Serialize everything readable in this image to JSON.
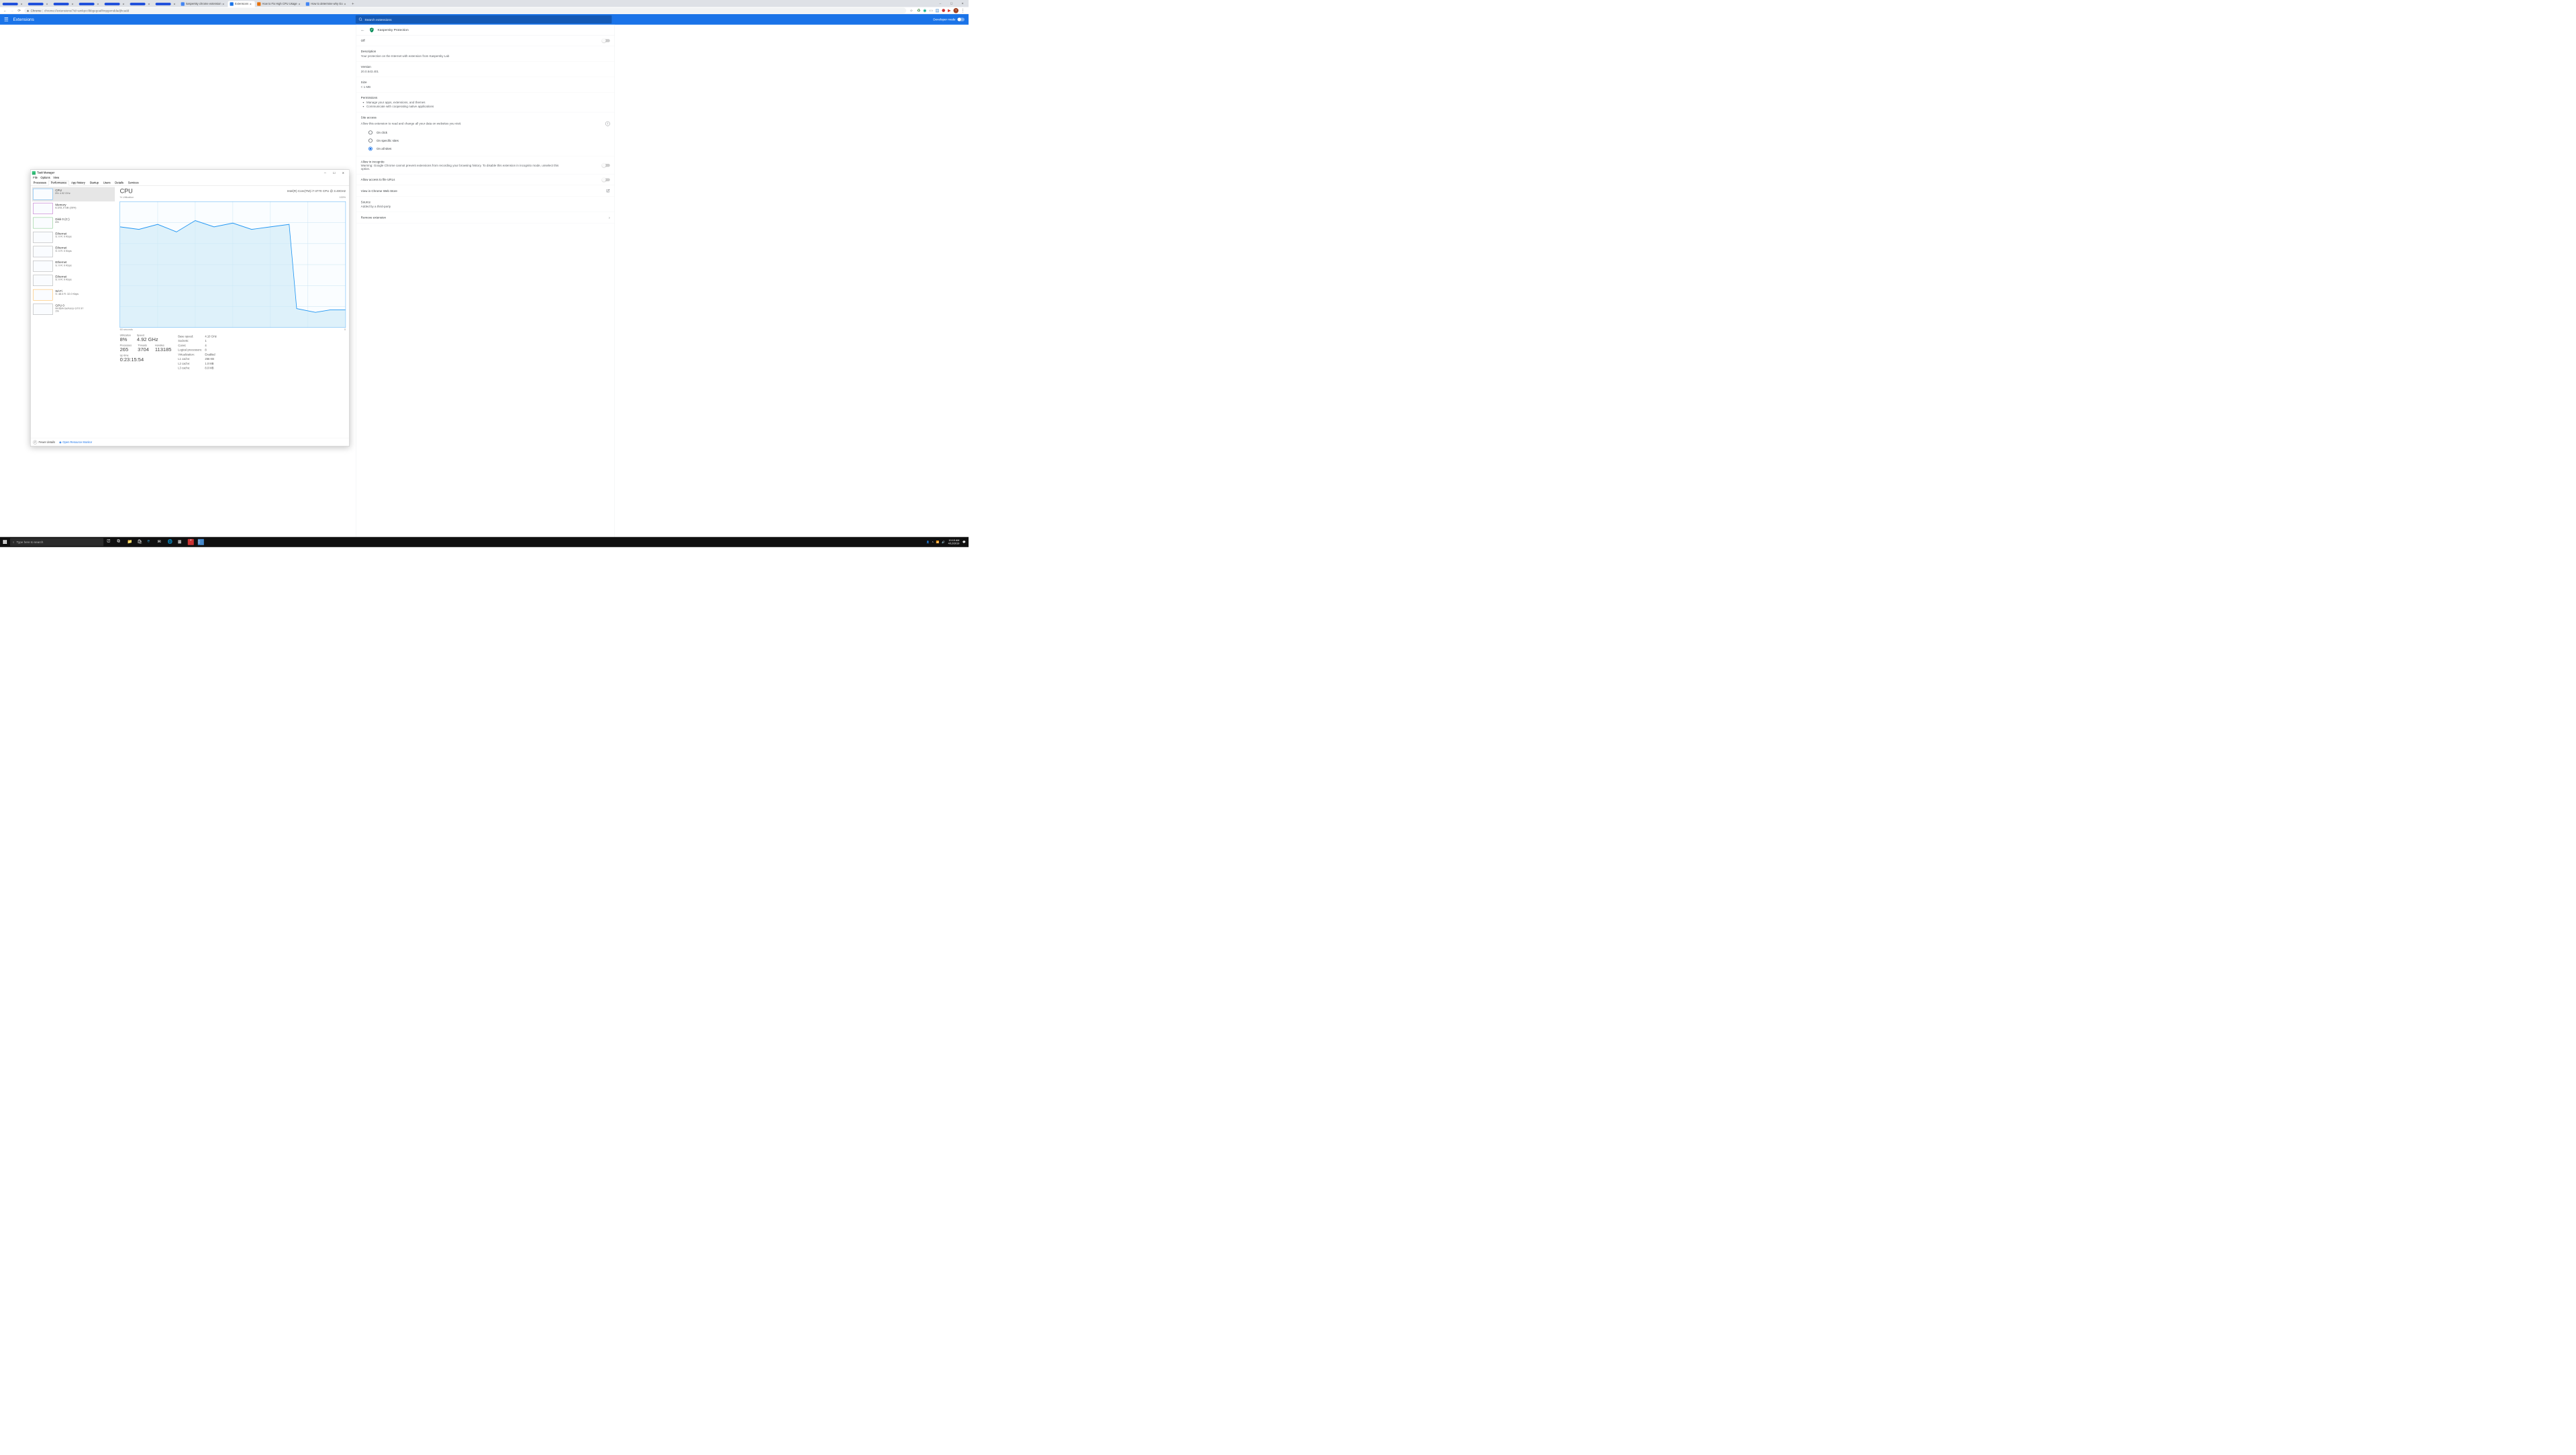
{
  "tabs": [
    {
      "txt": "",
      "redacted": true
    },
    {
      "txt": "",
      "redacted": true
    },
    {
      "txt": "",
      "redacted": true
    },
    {
      "txt": "",
      "redacted": true
    },
    {
      "txt": "",
      "redacted": true
    },
    {
      "txt": "",
      "redacted": true
    },
    {
      "txt": "",
      "redacted": true
    },
    {
      "txt": "kaspersky chrome extension",
      "favcolor": "#4285f4"
    },
    {
      "txt": "Extensions",
      "favcolor": "#1a73e8",
      "active": true
    },
    {
      "txt": "How to Fix High CPU Usage",
      "favcolor": "#e8710a"
    },
    {
      "txt": "How to determine why Go",
      "favcolor": "#4285f4"
    }
  ],
  "url_prefix": "Chrome",
  "url": "chrome://extensions/?id=amkpcclbbgegoafihnpgomddadjhcadd",
  "ext_header": {
    "title": "Extensions",
    "search_ph": "Search extensions",
    "devmode": "Developer mode"
  },
  "detail": {
    "name": "Kaspersky Protection",
    "off": "Off",
    "desc_lab": "Description",
    "desc": "Your protection on the Internet with extension from Kaspersky Lab",
    "ver_lab": "Version",
    "ver": "20.0.543.401",
    "size_lab": "Size",
    "size": "< 1 MB",
    "perm_lab": "Permissions",
    "perm1": "Manage your apps, extensions, and themes",
    "perm2": "Communicate with cooperating native applications",
    "siteaccess_lab": "Site access",
    "siteaccess_desc": "Allow this extension to read and change all your data on websites you visit:",
    "r1": "On click",
    "r2": "On specific sites",
    "r3": "On all sites",
    "incog_lab": "Allow in incognito",
    "incog_desc": "Warning: Google Chrome cannot prevent extensions from recording your browsing history. To disable this extension in incognito mode, unselect this option.",
    "fileurl": "Allow access to file URLs",
    "viewstore": "View in Chrome Web Store",
    "source_lab": "Source",
    "source": "Added by a third-party",
    "remove": "Remove extension"
  },
  "tm": {
    "title": "Task Manager",
    "menu": [
      "File",
      "Options",
      "View"
    ],
    "tabs": [
      "Processes",
      "Performance",
      "App history",
      "Startup",
      "Users",
      "Details",
      "Services"
    ],
    "side": [
      {
        "n": "CPU",
        "s": "8% 4.92 GHz",
        "cls": "cpu",
        "sel": true
      },
      {
        "n": "Memory",
        "s": "8.3/31.9 GB (26%)",
        "cls": "mem"
      },
      {
        "n": "Disk 0 (C:)",
        "s": "6%",
        "cls": "disk"
      },
      {
        "n": "Ethernet",
        "s": "S: 0  R: 0 Kbps",
        "cls": "eth"
      },
      {
        "n": "Ethernet",
        "s": "S: 0  R: 0 Kbps",
        "cls": "eth"
      },
      {
        "n": "Ethernet",
        "s": "S: 0  R: 0 Kbps",
        "cls": "eth"
      },
      {
        "n": "Ethernet",
        "s": "S: 0  R: 0 Kbps",
        "cls": "eth"
      },
      {
        "n": "Wi-Fi",
        "s": "S: 48.0  R: 32.0 Kbps",
        "cls": "wifi"
      },
      {
        "n": "GPU 0",
        "s": "NVIDIA GeForce GTX 97",
        "s2": "1%",
        "cls": "gpu"
      }
    ],
    "main": {
      "h": "CPU",
      "id": "Intel(R) Core(TM) i7-3770 CPU @ 3.40GHz",
      "ylab": "% Utilization",
      "ymax": "100%",
      "xlab": "60 seconds",
      "xright": "0",
      "util_lab": "Utilization",
      "util": "8%",
      "speed_lab": "Speed",
      "speed": "4.92 GHz",
      "proc_lab": "Processes",
      "proc": "265",
      "thr_lab": "Threads",
      "thr": "3704",
      "han_lab": "Handles",
      "han": "113185",
      "up_lab": "Up time",
      "up": "0:23:15:54",
      "r": [
        [
          "Base speed:",
          "4.10 GHz"
        ],
        [
          "Sockets:",
          "1"
        ],
        [
          "Cores:",
          "4"
        ],
        [
          "Logical processors:",
          "8"
        ],
        [
          "Virtualization:",
          "Enabled"
        ],
        [
          "L1 cache:",
          "256 KB"
        ],
        [
          "L2 cache:",
          "1.0 MB"
        ],
        [
          "L3 cache:",
          "8.0 MB"
        ]
      ]
    },
    "foot": {
      "fewer": "Fewer details",
      "orm": "Open Resource Monitor"
    }
  },
  "taskbar": {
    "search_ph": "Type here to search",
    "time": "10:15 AM",
    "date": "4/12/2019"
  },
  "chart_data": {
    "type": "line",
    "title": "CPU % Utilization",
    "xlabel": "60 seconds",
    "ylabel": "% Utilization",
    "ylim": [
      0,
      100
    ],
    "x": [
      0,
      5,
      10,
      15,
      20,
      25,
      30,
      35,
      40,
      45,
      50,
      55,
      60
    ],
    "values": [
      80,
      78,
      82,
      76,
      85,
      80,
      83,
      78,
      80,
      82,
      15,
      12,
      14
    ]
  }
}
